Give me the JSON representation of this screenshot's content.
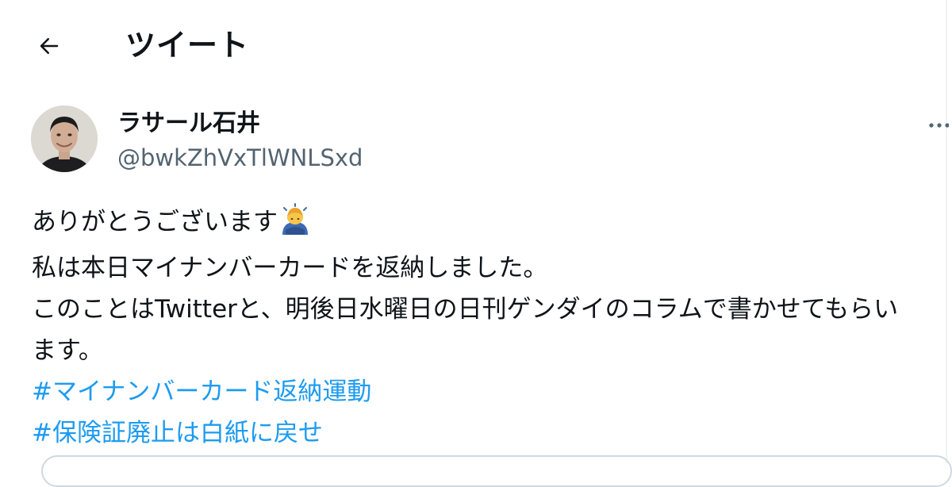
{
  "header": {
    "title": "ツイート",
    "back_icon": "arrow-left-icon"
  },
  "author": {
    "display_name": "ラサール石井",
    "handle": "@bwkZhVxTlWNLSxd",
    "avatar": "avatar-photo",
    "more_icon": "more-dots-icon"
  },
  "tweet": {
    "lines": [
      "ありがとうございます",
      "私は本日マイナンバーカードを返納しました。",
      "このことはTwitterと、明後日水曜日の日刊ゲンダイのコラムで書かせてもらい",
      "ます。"
    ],
    "emoji": "bowing-man-icon",
    "hashtags": [
      "#マイナンバーカード返納運動",
      "#保険証廃止は白紙に戻せ"
    ]
  },
  "colors": {
    "text": "#0f1419",
    "secondary": "#536471",
    "link": "#1d9bf0",
    "border": "#cfd9de"
  }
}
